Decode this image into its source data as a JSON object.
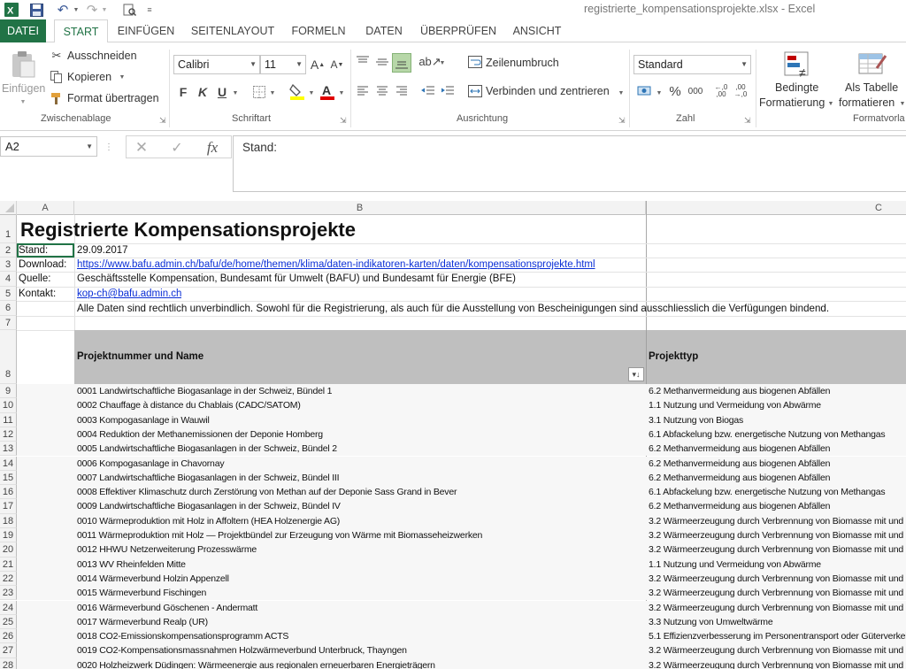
{
  "window": {
    "title": "registrierte_kompensationsprojekte.xlsx - Excel"
  },
  "menu": {
    "tabs": [
      "DATEI",
      "START",
      "EINFÜGEN",
      "SEITENLAYOUT",
      "FORMELN",
      "DATEN",
      "ÜBERPRÜFEN",
      "ANSICHT"
    ]
  },
  "ribbon": {
    "paste_label": "Einfügen",
    "cut_label": "Ausschneiden",
    "copy_label": "Kopieren",
    "format_painter_label": "Format übertragen",
    "clipboard_group": "Zwischenablage",
    "font_name": "Calibri",
    "font_size": "11",
    "font_group": "Schriftart",
    "bold": "F",
    "italic": "K",
    "underline": "U",
    "wrap_text_label": "Zeilenumbruch",
    "merge_center_label": "Verbinden und zentrieren",
    "alignment_group": "Ausrichtung",
    "number_format": "Standard",
    "number_group": "Zahl",
    "percent": "%",
    "thousands": "000",
    "conditional_line1": "Bedingte",
    "conditional_line2": "Formatierung",
    "table_line1": "Als Tabelle",
    "table_line2": "formatieren",
    "styles_group": "Formatvorla"
  },
  "formula_bar": {
    "name_box": "A2",
    "content": "Stand:",
    "fx": "fx"
  },
  "columns": [
    "A",
    "B",
    "C"
  ],
  "rows": {
    "r1": {
      "num": "1",
      "a": "Registrierte Kompensationsprojekte"
    },
    "r2": {
      "num": "2",
      "a": "Stand:",
      "b": "29.09.2017"
    },
    "r3": {
      "num": "3",
      "a": "Download:",
      "b": "https://www.bafu.admin.ch/bafu/de/home/themen/klima/daten-indikatoren-karten/daten/kompensationsprojekte.html"
    },
    "r4": {
      "num": "4",
      "a": "Quelle:",
      "b": "Geschäftsstelle Kompensation, Bundesamt für Umwelt (BAFU) und Bundesamt für Energie (BFE)"
    },
    "r5": {
      "num": "5",
      "a": "Kontakt:",
      "b": "kop-ch@bafu.admin.ch"
    },
    "r6": {
      "num": "6",
      "b": "Alle Daten sind rechtlich unverbindlich. Sowohl für die Registrierung, als auch für die Ausstellung von Bescheinigungen sind ausschliesslich die Verfügungen bindend."
    },
    "r7": {
      "num": "7"
    },
    "r8": {
      "num": "8",
      "b": "Projektnummer und Name",
      "c": "Projekttyp"
    }
  },
  "data_rows": [
    {
      "num": "9",
      "b": "0001 Landwirtschaftliche Biogasanlage in der Schweiz, Bündel 1",
      "c": "6.2 Methanvermeidung aus biogenen Abfällen"
    },
    {
      "num": "10",
      "b": "0002 Chauffage à distance du Chablais (CADC/SATOM)",
      "c": "1.1 Nutzung und Vermeidung von Abwärme"
    },
    {
      "num": "11",
      "b": "0003 Kompogasanlage in Wauwil",
      "c": "3.1 Nutzung von Biogas"
    },
    {
      "num": "12",
      "b": "0004 Reduktion der Methanemissionen der Deponie Homberg",
      "c": "6.1 Abfackelung bzw. energetische Nutzung von Methangas"
    },
    {
      "num": "13",
      "b": "0005 Landwirtschaftliche Biogasanlagen in der Schweiz, Bündel 2",
      "c": "6.2 Methanvermeidung aus biogenen Abfällen"
    },
    {
      "num": "14",
      "b": "0006 Kompogasanlage in Chavornay",
      "c": "6.2 Methanvermeidung aus biogenen Abfällen"
    },
    {
      "num": "15",
      "b": "0007 Landwirtschaftliche Biogasanlagen in der Schweiz, Bündel III",
      "c": "6.2 Methanvermeidung aus biogenen Abfällen"
    },
    {
      "num": "16",
      "b": "0008 Effektiver Klimaschutz durch Zerstörung von Methan auf der Deponie Sass Grand in Bever",
      "c": "6.1 Abfackelung bzw. energetische Nutzung von Methangas"
    },
    {
      "num": "17",
      "b": "0009 Landwirtschaftliche Biogasanlagen in der Schweiz, Bündel IV",
      "c": "6.2 Methanvermeidung aus biogenen Abfällen"
    },
    {
      "num": "18",
      "b": "0010 Wärmeproduktion mit Holz in Affoltern (HEA Holzenergie AG)",
      "c": "3.2 Wärmeerzeugung durch Verbrennung von Biomasse mit und"
    },
    {
      "num": "19",
      "b": "0011 Wärmeproduktion mit Holz — Projektbündel zur Erzeugung von Wärme mit Biomasseheizwerken",
      "c": "3.2 Wärmeerzeugung durch Verbrennung von Biomasse mit und"
    },
    {
      "num": "20",
      "b": "0012 HHWU Netzerweiterung Prozesswärme",
      "c": "3.2 Wärmeerzeugung durch Verbrennung von Biomasse mit und"
    },
    {
      "num": "21",
      "b": "0013 WV Rheinfelden Mitte",
      "c": "1.1 Nutzung und Vermeidung von Abwärme"
    },
    {
      "num": "22",
      "b": "0014 Wärmeverbund Holzin Appenzell",
      "c": "3.2 Wärmeerzeugung durch Verbrennung von Biomasse mit und"
    },
    {
      "num": "23",
      "b": "0015 Wärmeverbund Fischingen",
      "c": "3.2 Wärmeerzeugung durch Verbrennung von Biomasse mit und"
    },
    {
      "num": "24",
      "b": "0016 Wärmeverbund Göschenen - Andermatt",
      "c": "3.2 Wärmeerzeugung durch Verbrennung von Biomasse mit und"
    },
    {
      "num": "25",
      "b": "0017 Wärmeverbund Realp (UR)",
      "c": "3.3 Nutzung von Umweltwärme"
    },
    {
      "num": "26",
      "b": "0018 CO2-Emissionskompensationsprogramm ACTS",
      "c": "5.1 Effizienzverbesserung im Personentransport oder Güterverkel"
    },
    {
      "num": "27",
      "b": "0019 CO2-Kompensationsmassnahmen Holzwärmeverbund Unterbruck, Thayngen",
      "c": "3.2 Wärmeerzeugung durch Verbrennung von Biomasse mit und"
    },
    {
      "num": "28",
      "b": "0020 Holzheizwerk Düdingen: Wärmeenergie aus regionalen erneuerbaren Energieträgern",
      "c": "3.2 Wärmeerzeugung durch Verbrennung von Biomasse mit und"
    }
  ]
}
